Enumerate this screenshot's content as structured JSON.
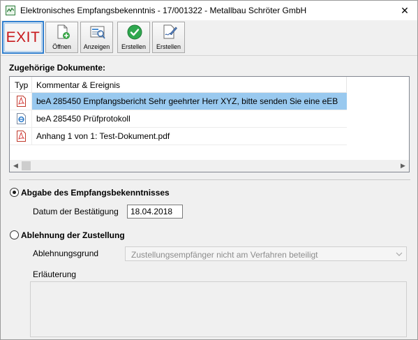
{
  "window": {
    "title": "Elektronisches Empfangsbekenntnis - 17/001322 - Metallbau Schröter GmbH",
    "close_glyph": "✕"
  },
  "toolbar": {
    "exit_label": "EXIT",
    "buttons": [
      {
        "label": "Öffnen",
        "icon": "open-document-icon"
      },
      {
        "label": "Anzeigen",
        "icon": "view-document-icon"
      },
      {
        "label": "Erstellen",
        "icon": "checkmark-icon"
      },
      {
        "label": "Erstellen",
        "icon": "sign-document-icon"
      }
    ]
  },
  "documents": {
    "section_label": "Zugehörige Dokumente:",
    "columns": [
      "Typ",
      "Kommentar & Ereignis"
    ],
    "rows": [
      {
        "type_icon": "pdf-file-icon",
        "text": "beA 285450 Empfangsbericht  Sehr geehrter Herr XYZ,  bitte senden Sie eine eEB",
        "selected": true
      },
      {
        "type_icon": "html-file-icon",
        "text": "beA 285450 Prüfprotokoll",
        "selected": false
      },
      {
        "type_icon": "pdf-file-icon",
        "text": "Anhang 1 von 1: Test-Dokument.pdf",
        "selected": false
      }
    ]
  },
  "acceptance": {
    "label": "Abgabe des Empfangsbekenntnisses",
    "selected": true,
    "date_label": "Datum der Bestätigung",
    "date_value": "18.04.2018"
  },
  "rejection": {
    "label": "Ablehnung der Zustellung",
    "selected": false,
    "reason_label": "Ablehnungsgrund",
    "reason_value": "Zustellungsempfänger nicht am Verfahren beteiligt",
    "explanation_label": "Erläuterung",
    "explanation_value": ""
  },
  "colors": {
    "exit_text": "#c8191c",
    "selection": "#99c9ef",
    "focus_border": "#2f7fd0"
  }
}
